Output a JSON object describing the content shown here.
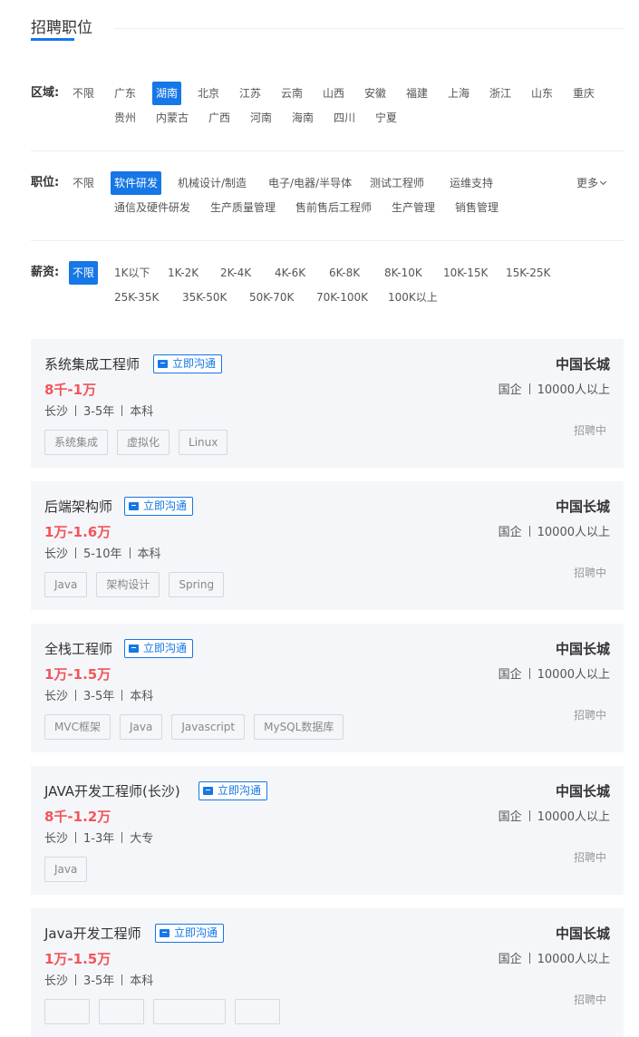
{
  "section": {
    "title": "招聘职位"
  },
  "filters": {
    "region": {
      "label": "区域:",
      "options": [
        "不限",
        "广东",
        "湖南",
        "北京",
        "江苏",
        "云南",
        "山西",
        "安徽",
        "福建",
        "上海",
        "浙江",
        "山东",
        "重庆",
        "贵州",
        "内蒙古",
        "广西",
        "河南",
        "海南",
        "四川",
        "宁夏"
      ],
      "selected": "湖南"
    },
    "position": {
      "label": "职位:",
      "options": [
        "不限",
        "软件研发",
        "机械设计/制造",
        "电子/电器/半导体",
        "测试工程师",
        "运维支持",
        "通信及硬件研发",
        "生产质量管理",
        "售前售后工程师",
        "生产管理",
        "销售管理"
      ],
      "selected": "软件研发",
      "more_label": "更多"
    },
    "salary": {
      "label": "薪资:",
      "options": [
        "不限",
        "1K以下",
        "1K-2K",
        "2K-4K",
        "4K-6K",
        "6K-8K",
        "8K-10K",
        "10K-15K",
        "15K-25K",
        "25K-35K",
        "35K-50K",
        "50K-70K",
        "70K-100K",
        "100K以上"
      ],
      "selected": "不限"
    }
  },
  "chat_label": "立即沟通",
  "jobs": [
    {
      "title": "系统集成工程师",
      "salary": "8千-1万",
      "city": "长沙",
      "experience": "3-5年",
      "education": "本科",
      "tags": [
        "系统集成",
        "虚拟化",
        "Linux"
      ],
      "company": "中国长城",
      "company_type": "国企",
      "company_size": "10000人以上",
      "status": "招聘中"
    },
    {
      "title": "后端架构师",
      "salary": "1万-1.6万",
      "city": "长沙",
      "experience": "5-10年",
      "education": "本科",
      "tags": [
        "Java",
        "架构设计",
        "Spring"
      ],
      "company": "中国长城",
      "company_type": "国企",
      "company_size": "10000人以上",
      "status": "招聘中"
    },
    {
      "title": "全栈工程师",
      "salary": "1万-1.5万",
      "city": "长沙",
      "experience": "3-5年",
      "education": "本科",
      "tags": [
        "MVC框架",
        "Java",
        "Javascript",
        "MySQL数据库"
      ],
      "company": "中国长城",
      "company_type": "国企",
      "company_size": "10000人以上",
      "status": "招聘中"
    },
    {
      "title": "JAVA开发工程师(长沙)",
      "salary": "8千-1.2万",
      "city": "长沙",
      "experience": "1-3年",
      "education": "大专",
      "tags": [
        "Java"
      ],
      "company": "中国长城",
      "company_type": "国企",
      "company_size": "10000人以上",
      "status": "招聘中"
    },
    {
      "title": "Java开发工程师",
      "salary": "1万-1.5万",
      "city": "长沙",
      "experience": "3-5年",
      "education": "本科",
      "tags": [],
      "company": "中国长城",
      "company_type": "国企",
      "company_size": "10000人以上",
      "status": "招聘中"
    }
  ],
  "colors": {
    "accent": "#1677e6",
    "salary": "#f2555a",
    "card_bg": "#f5f6f9"
  }
}
